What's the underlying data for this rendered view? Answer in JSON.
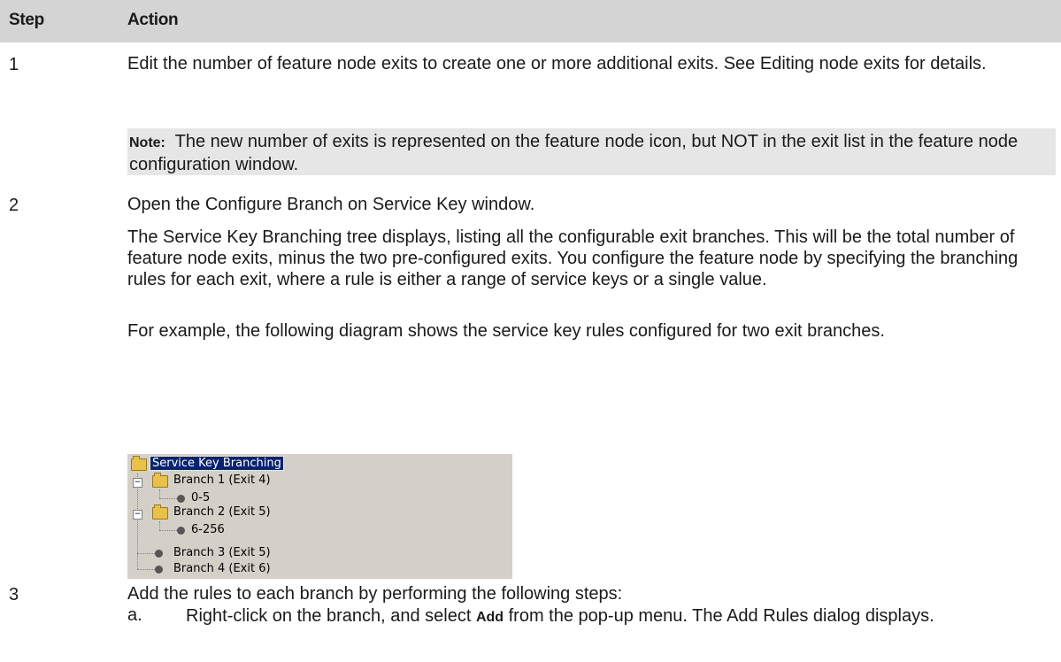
{
  "table": {
    "header": {
      "step": "Step",
      "action": "Action"
    },
    "step1": {
      "number": "1",
      "text": "Edit the number of feature node exits to create one or more additional exits. See Editing node exits for details.",
      "note_label": "Note:",
      "note_text": "The new number of exits is represented on the feature node icon, but NOT in the exit list in the feature node configuration window."
    },
    "step2": {
      "number": "2",
      "p1": "Open the Configure Branch on Service Key window.",
      "p2": "The Service Key Branching tree displays, listing all the configurable exit branches. This will be the total number of feature node exits, minus the two pre-configured exits. You configure the feature node by specifying the branching rules for each exit, where a rule is either a range of service keys or a single value.",
      "p3": "For example, the following diagram shows the service key rules configured for two exit branches."
    },
    "tree": {
      "root": "Service Key Branching",
      "branch1": "Branch 1 (Exit 4)",
      "branch1_rule": "0-5",
      "branch2": "Branch 2 (Exit 5)",
      "branch2_rule": "6-256",
      "branch3": "Branch 3 (Exit 5)",
      "branch4": "Branch 4 (Exit 6)"
    },
    "step3": {
      "number": "3",
      "intro": "Add the rules to each branch by performing the following steps:",
      "sub_a_marker": "a.",
      "sub_a_pre": "Right-click on the branch, and select ",
      "sub_a_bold": "Add",
      "sub_a_post": " from the pop-up menu. The Add Rules dialog displays."
    }
  }
}
